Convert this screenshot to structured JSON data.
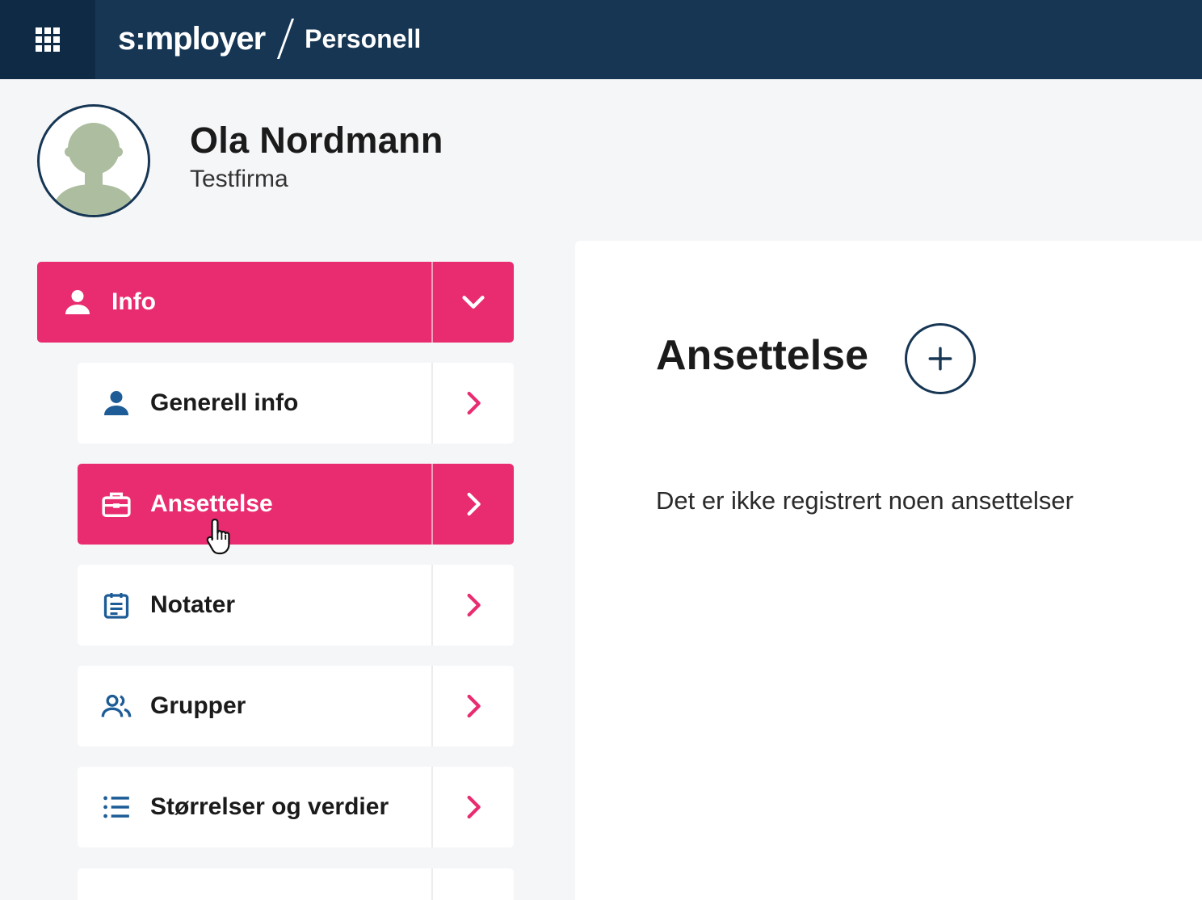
{
  "header": {
    "logo_text": "s:mployer",
    "module_title": "Personell",
    "apps_icon": "grid-icon"
  },
  "profile": {
    "name": "Ola Nordmann",
    "company": "Testfirma"
  },
  "menu": {
    "info": {
      "label": "Info",
      "icon": "user-icon",
      "toggle_icon": "chevron-down-icon",
      "active": true
    },
    "items": [
      {
        "label": "Generell info",
        "icon": "user-icon",
        "active": false
      },
      {
        "label": "Ansettelse",
        "icon": "briefcase-icon",
        "active": true
      },
      {
        "label": "Notater",
        "icon": "notes-icon",
        "active": false
      },
      {
        "label": "Grupper",
        "icon": "group-icon",
        "active": false
      },
      {
        "label": "Størrelser og verdier",
        "icon": "list-icon",
        "active": false
      }
    ]
  },
  "content": {
    "title": "Ansettelse",
    "add_icon": "plus-icon",
    "empty_message": "Det er ikke registrert noen ansettelser"
  },
  "colors": {
    "topbar": "#163654",
    "accent": "#e82c6f",
    "icon_blue": "#1d5c96"
  }
}
